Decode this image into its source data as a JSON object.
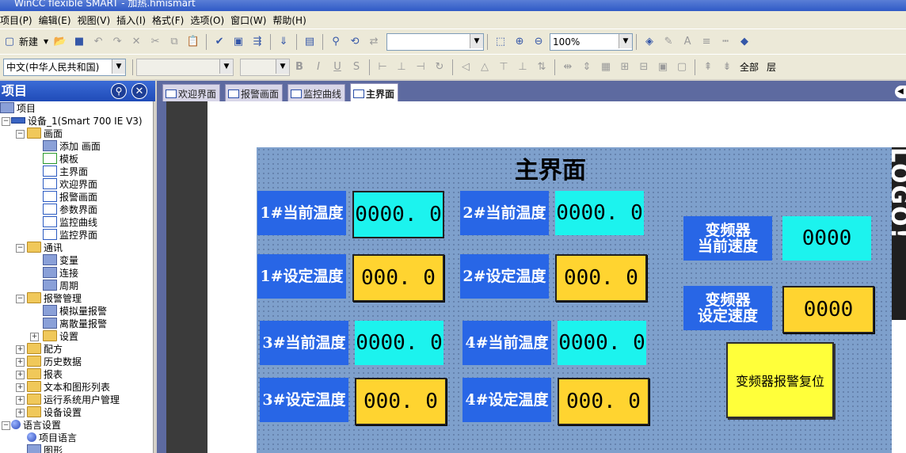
{
  "window": {
    "title": "WinCC flexible SMART - 加热.hmismart"
  },
  "menubar": {
    "items": [
      "项目(P)",
      "编辑(E)",
      "视图(V)",
      "插入(I)",
      "格式(F)",
      "选项(O)",
      "窗口(W)",
      "帮助(H)"
    ]
  },
  "toolbar": {
    "new_label": "新建",
    "zoom_value": "100%",
    "language_value": "中文(中华人民共和国)",
    "all_label": "全部",
    "layer_label": "层"
  },
  "project_tree": {
    "header": "项目",
    "items": [
      {
        "label": "项目",
        "icon": "project-icon"
      },
      {
        "label": "设备_1(Smart 700 IE V3)",
        "icon": "device-icon"
      },
      {
        "label": "画面",
        "icon": "folder-icon"
      },
      {
        "label": "添加 画面",
        "icon": "add-screen-icon"
      },
      {
        "label": "模板",
        "icon": "template-icon"
      },
      {
        "label": "主界面",
        "icon": "screen-icon"
      },
      {
        "label": "欢迎界面",
        "icon": "screen-icon"
      },
      {
        "label": "报警画面",
        "icon": "screen-icon"
      },
      {
        "label": "参数界面",
        "icon": "screen-icon"
      },
      {
        "label": "监控曲线",
        "icon": "screen-icon"
      },
      {
        "label": "监控界面",
        "icon": "screen-icon"
      },
      {
        "label": "通讯",
        "icon": "folder-icon"
      },
      {
        "label": "变量",
        "icon": "tag-icon"
      },
      {
        "label": "连接",
        "icon": "connection-icon"
      },
      {
        "label": "周期",
        "icon": "cycle-icon"
      },
      {
        "label": "报警管理",
        "icon": "folder-icon"
      },
      {
        "label": "模拟量报警",
        "icon": "analog-alarm-icon"
      },
      {
        "label": "离散量报警",
        "icon": "discrete-alarm-icon"
      },
      {
        "label": "设置",
        "icon": "folder-icon"
      },
      {
        "label": "配方",
        "icon": "folder-icon"
      },
      {
        "label": "历史数据",
        "icon": "folder-icon"
      },
      {
        "label": "报表",
        "icon": "folder-icon"
      },
      {
        "label": "文本和图形列表",
        "icon": "folder-icon"
      },
      {
        "label": "运行系统用户管理",
        "icon": "folder-icon"
      },
      {
        "label": "设备设置",
        "icon": "folder-icon"
      },
      {
        "label": "语言设置",
        "icon": "globe-icon"
      },
      {
        "label": "项目语言",
        "icon": "globe-icon"
      },
      {
        "label": "图形",
        "icon": "graphics-icon"
      }
    ]
  },
  "tabs": [
    {
      "label": "欢迎界面"
    },
    {
      "label": "报警画面"
    },
    {
      "label": "监控曲线"
    },
    {
      "label": "主界面"
    }
  ],
  "hmi": {
    "title": "主界面",
    "fields": [
      {
        "label": "1#当前温度",
        "value": "0000. 0"
      },
      {
        "label": "2#当前温度",
        "value": "0000. 0"
      },
      {
        "label": "1#设定温度",
        "value": "000. 0"
      },
      {
        "label": "2#设定温度",
        "value": "000. 0"
      },
      {
        "label": "3#当前温度",
        "value": "0000. 0"
      },
      {
        "label": "4#当前温度",
        "value": "0000. 0"
      },
      {
        "label": "3#设定温度",
        "value": "000. 0"
      },
      {
        "label": "4#设定温度",
        "value": "000. 0"
      }
    ],
    "vfd_current": {
      "label_line1": "变频器",
      "label_line2": "当前速度",
      "value": "0000"
    },
    "vfd_setpoint": {
      "label_line1": "变频器",
      "label_line2": "设定速度",
      "value": "0000"
    },
    "reset_button": "变频器报警复位",
    "right_strip_text": "LOGO!"
  },
  "colors": {
    "label_bg": "#2866e6",
    "io_output": "#1cf3ee",
    "io_input": "#ffd430",
    "button": "#ffff3a",
    "canvas": "#7ea0cc"
  }
}
